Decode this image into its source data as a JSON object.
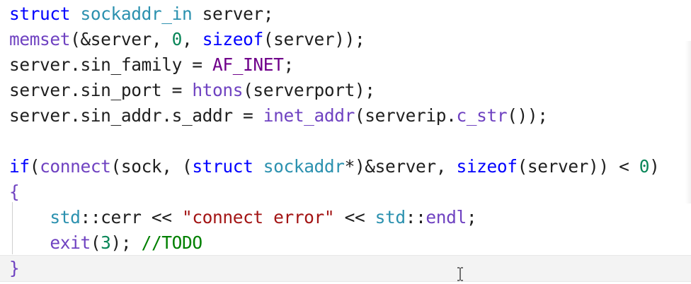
{
  "code": {
    "language": "C++",
    "lines": [
      [
        [
          "kw",
          "struct"
        ],
        [
          "pn",
          " "
        ],
        [
          "ty",
          "sockaddr_in"
        ],
        [
          "pn",
          " server;"
        ]
      ],
      [
        [
          "fn",
          "memset"
        ],
        [
          "pn",
          "(&server, "
        ],
        [
          "num",
          "0"
        ],
        [
          "pn",
          ", "
        ],
        [
          "kw",
          "sizeof"
        ],
        [
          "pn",
          "(server));"
        ]
      ],
      [
        [
          "pn",
          "server.sin_family = "
        ],
        [
          "mac",
          "AF_INET"
        ],
        [
          "pn",
          ";"
        ]
      ],
      [
        [
          "pn",
          "server.sin_port = "
        ],
        [
          "fn",
          "htons"
        ],
        [
          "pn",
          "(serverport);"
        ]
      ],
      [
        [
          "pn",
          "server.sin_addr.s_addr = "
        ],
        [
          "fn",
          "inet_addr"
        ],
        [
          "pn",
          "(serverip."
        ],
        [
          "fn",
          "c_str"
        ],
        [
          "pn",
          "());"
        ]
      ],
      [],
      [
        [
          "kw",
          "if"
        ],
        [
          "pn",
          "("
        ],
        [
          "fn",
          "connect"
        ],
        [
          "pn",
          "(sock, ("
        ],
        [
          "kw",
          "struct"
        ],
        [
          "pn",
          " "
        ],
        [
          "ty",
          "sockaddr"
        ],
        [
          "pn",
          "*)&server, "
        ],
        [
          "kw",
          "sizeof"
        ],
        [
          "pn",
          "(server)) < "
        ],
        [
          "num",
          "0"
        ],
        [
          "pn",
          ")"
        ]
      ],
      [
        [
          "brace",
          "{"
        ]
      ],
      [
        [
          "pn",
          "    "
        ],
        [
          "ty",
          "std"
        ],
        [
          "pn",
          "::"
        ],
        [
          "id",
          "cerr"
        ],
        [
          "pn",
          " << "
        ],
        [
          "str",
          "\"connect error\""
        ],
        [
          "pn",
          " << "
        ],
        [
          "ty",
          "std"
        ],
        [
          "pn",
          "::"
        ],
        [
          "fn",
          "endl"
        ],
        [
          "pn",
          ";"
        ]
      ],
      [
        [
          "pn",
          "    "
        ],
        [
          "fn",
          "exit"
        ],
        [
          "pn",
          "("
        ],
        [
          "num",
          "3"
        ],
        [
          "pn",
          "); "
        ],
        [
          "cm",
          "//TODO"
        ]
      ],
      [
        [
          "brace",
          "}"
        ]
      ]
    ]
  },
  "colors": {
    "keyword": "#0000ff",
    "type": "#2b91af",
    "function": "#6f42c1",
    "number": "#098658",
    "string": "#a31515",
    "comment": "#008000",
    "macro": "#6f008a"
  }
}
